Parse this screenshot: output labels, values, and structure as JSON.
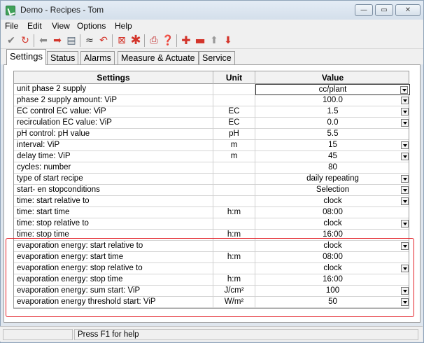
{
  "window": {
    "title": "Demo - Recipes - Tom",
    "minimize": "—",
    "maximize": "▭",
    "close": "✕"
  },
  "menu": [
    "File",
    "Edit",
    "View",
    "Options",
    "Help"
  ],
  "toolbar_icons": [
    "check-icon",
    "refresh-icon",
    "arrow-left-icon",
    "arrow-right-icon",
    "list-icon",
    "collapse-icon",
    "undo-icon",
    "delete-box-icon",
    "asterisk-icon",
    "print-icon",
    "help-icon",
    "add-icon",
    "remove-icon",
    "arrow-up-icon",
    "arrow-down-icon"
  ],
  "tabs": [
    "Settings",
    "Status",
    "Alarms",
    "Measure & Actuate",
    "Service"
  ],
  "grid": {
    "headers": {
      "settings": "Settings",
      "unit": "Unit",
      "value": "Value"
    },
    "rows": [
      {
        "setting": "unit phase 2 supply",
        "unit": "",
        "value": "cc/plant",
        "dropdown": true
      },
      {
        "setting": "phase 2 supply amount: ViP",
        "unit": "",
        "value": "100.0",
        "dropdown": true
      },
      {
        "setting": "EC control EC value: ViP",
        "unit": "EC",
        "value": "1.5",
        "dropdown": true
      },
      {
        "setting": "recirculation EC value: ViP",
        "unit": "EC",
        "value": "0.0",
        "dropdown": true
      },
      {
        "setting": "pH control: pH value",
        "unit": "pH",
        "value": "5.5",
        "dropdown": false
      },
      {
        "setting": "interval: ViP",
        "unit": "m",
        "value": "15",
        "dropdown": true
      },
      {
        "setting": "delay time: ViP",
        "unit": "m",
        "value": "45",
        "dropdown": true
      },
      {
        "setting": "cycles: number",
        "unit": "",
        "value": "80",
        "dropdown": false
      },
      {
        "setting": "type of start recipe",
        "unit": "",
        "value": "daily repeating",
        "dropdown": true
      },
      {
        "setting": "start- en stopconditions",
        "unit": "",
        "value": "Selection",
        "dropdown": true
      },
      {
        "setting": "time: start relative to",
        "unit": "",
        "value": "clock",
        "dropdown": true
      },
      {
        "setting": "time: start time",
        "unit": "h:m",
        "value": "08:00",
        "dropdown": false
      },
      {
        "setting": "time: stop relative to",
        "unit": "",
        "value": "clock",
        "dropdown": true
      },
      {
        "setting": "time: stop time",
        "unit": "h:m",
        "value": "16:00",
        "dropdown": false
      },
      {
        "setting": "evaporation energy: start relative to",
        "unit": "",
        "value": "clock",
        "dropdown": true
      },
      {
        "setting": "evaporation energy: start time",
        "unit": "h:m",
        "value": "08:00",
        "dropdown": false
      },
      {
        "setting": "evaporation energy: stop relative to",
        "unit": "",
        "value": "clock",
        "dropdown": true
      },
      {
        "setting": "evaporation energy: stop time",
        "unit": "h:m",
        "value": "16:00",
        "dropdown": false
      },
      {
        "setting": "evaporation energy: sum start: ViP",
        "unit": "J/cm²",
        "value": "100",
        "dropdown": true
      },
      {
        "setting": "evaporation energy threshold start: ViP",
        "unit": "W/m²",
        "value": "50",
        "dropdown": true
      }
    ]
  },
  "statusbar": {
    "help_text": "Press F1 for help"
  },
  "colors": {
    "highlight": "#e21f26",
    "window_bg": "#dfe6ee"
  }
}
